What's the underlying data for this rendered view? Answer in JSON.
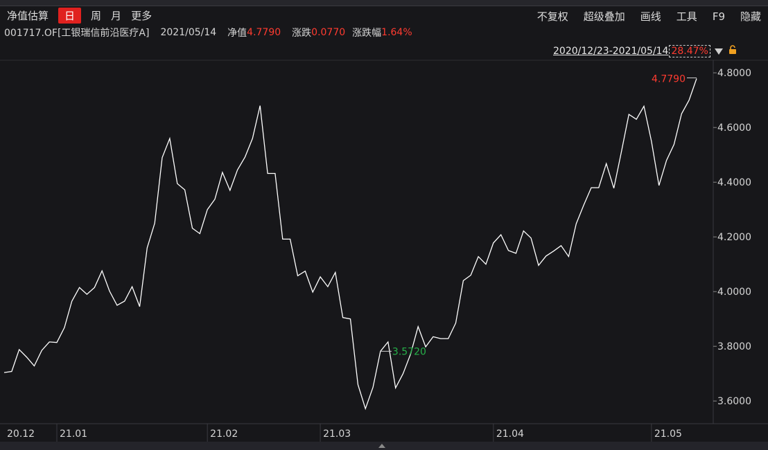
{
  "toolbar": {
    "left_items": [
      "净值估算",
      "日",
      "周",
      "月",
      "更多"
    ],
    "active_index": 1,
    "right_items": [
      "不复权",
      "超级叠加",
      "画线",
      "工具",
      "F9",
      "隐藏"
    ]
  },
  "info": {
    "code_name": "001717.OF[工银瑞信前沿医疗A]",
    "date": "2021/05/14",
    "nav_label": "净值",
    "nav_value": "4.7790",
    "change_label": "涨跌",
    "change_value": "0.0770",
    "pct_label": "涨跌幅",
    "pct_value": "1.64%"
  },
  "range": {
    "text": "2020/12/23-2021/05/14",
    "pct": "28.47%"
  },
  "colors": {
    "background": "#17171a",
    "line": "#ffffff",
    "up": "#ff3b30",
    "down": "#27b24a",
    "grid": "#2c2c31",
    "active_tab": "#e0211f"
  },
  "chart_data": {
    "type": "line",
    "x": [
      "2020-12-23",
      "2020-12-24",
      "2020-12-25",
      "2020-12-28",
      "2020-12-29",
      "2020-12-30",
      "2020-12-31",
      "2021-01-04",
      "2021-01-05",
      "2021-01-06",
      "2021-01-07",
      "2021-01-08",
      "2021-01-11",
      "2021-01-12",
      "2021-01-13",
      "2021-01-14",
      "2021-01-15",
      "2021-01-18",
      "2021-01-19",
      "2021-01-20",
      "2021-01-21",
      "2021-01-22",
      "2021-01-25",
      "2021-01-26",
      "2021-01-27",
      "2021-01-28",
      "2021-01-29",
      "2021-02-01",
      "2021-02-02",
      "2021-02-03",
      "2021-02-04",
      "2021-02-05",
      "2021-02-08",
      "2021-02-09",
      "2021-02-10",
      "2021-02-18",
      "2021-02-19",
      "2021-02-22",
      "2021-02-23",
      "2021-02-24",
      "2021-02-25",
      "2021-02-26",
      "2021-03-01",
      "2021-03-02",
      "2021-03-03",
      "2021-03-04",
      "2021-03-05",
      "2021-03-08",
      "2021-03-09",
      "2021-03-10",
      "2021-03-11",
      "2021-03-12",
      "2021-03-15",
      "2021-03-16",
      "2021-03-17",
      "2021-03-18",
      "2021-03-19",
      "2021-03-22",
      "2021-03-23",
      "2021-03-24",
      "2021-03-25",
      "2021-03-26",
      "2021-03-29",
      "2021-03-30",
      "2021-03-31",
      "2021-04-01",
      "2021-04-02",
      "2021-04-06",
      "2021-04-07",
      "2021-04-08",
      "2021-04-09",
      "2021-04-12",
      "2021-04-13",
      "2021-04-14",
      "2021-04-15",
      "2021-04-16",
      "2021-04-19",
      "2021-04-20",
      "2021-04-21",
      "2021-04-22",
      "2021-04-23",
      "2021-04-26",
      "2021-04-27",
      "2021-04-28",
      "2021-04-29",
      "2021-04-30",
      "2021-05-06",
      "2021-05-07",
      "2021-05-10",
      "2021-05-11",
      "2021-05-12",
      "2021-05-13",
      "2021-05-14"
    ],
    "series": [
      {
        "values": [
          3.704,
          3.708,
          3.788,
          3.76,
          3.728,
          3.785,
          3.816,
          3.814,
          3.868,
          3.965,
          4.015,
          3.99,
          4.015,
          4.076,
          4.002,
          3.95,
          3.965,
          4.018,
          3.945,
          4.16,
          4.25,
          4.49,
          4.56,
          4.395,
          4.372,
          4.232,
          4.212,
          4.3,
          4.338,
          4.436,
          4.37,
          4.445,
          4.492,
          4.56,
          4.68,
          4.432,
          4.432,
          4.192,
          4.192,
          4.058,
          4.075,
          3.998,
          4.054,
          4.018,
          4.07,
          3.905,
          3.9,
          3.66,
          3.572,
          3.65,
          3.782,
          3.816,
          3.648,
          3.7,
          3.772,
          3.872,
          3.798,
          3.835,
          3.828,
          3.828,
          3.885,
          4.04,
          4.06,
          4.128,
          4.1,
          4.178,
          4.208,
          4.15,
          4.14,
          4.222,
          4.196,
          4.096,
          4.13,
          4.148,
          4.168,
          4.128,
          4.248,
          4.316,
          4.38,
          4.38,
          4.468,
          4.378,
          4.51,
          4.648,
          4.63,
          4.678,
          4.55,
          4.388,
          4.48,
          4.538,
          4.65,
          4.7,
          4.779
        ]
      }
    ],
    "yticks": [
      "4.8000",
      "4.6000",
      "4.4000",
      "4.2000",
      "4.0000",
      "3.8000",
      "3.6000"
    ],
    "ylim": [
      3.517,
      4.846
    ],
    "xticks": [
      "20.12",
      "21.01",
      "21.02",
      "21.03",
      "21.04",
      "21.05"
    ],
    "xtick_dates": [
      "2020-12-23",
      "2021-01-04",
      "2021-02-01",
      "2021-03-01",
      "2021-04-01",
      "2021-05-06"
    ],
    "annotations": [
      {
        "date": "2021-05-14",
        "text": "4.7790",
        "color": "up"
      },
      {
        "date": "2021-03-11",
        "text": "3.5720",
        "color": "down"
      }
    ]
  }
}
